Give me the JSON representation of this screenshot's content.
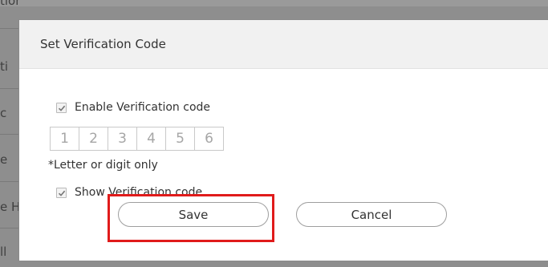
{
  "background": {
    "labels": [
      "tion",
      "ti",
      "c",
      "e",
      "e H",
      "ll"
    ]
  },
  "dialog": {
    "title": "Set Verification Code",
    "enable_verification_label": "Enable Verification code",
    "code_digits": [
      "1",
      "2",
      "3",
      "4",
      "5",
      "6"
    ],
    "hint": "*Letter or digit only",
    "show_verification_label": "Show Verification code",
    "save_label": "Save",
    "cancel_label": "Cancel"
  },
  "colors": {
    "highlight": "#e01b1b",
    "overlay": "#8e8e8e"
  }
}
